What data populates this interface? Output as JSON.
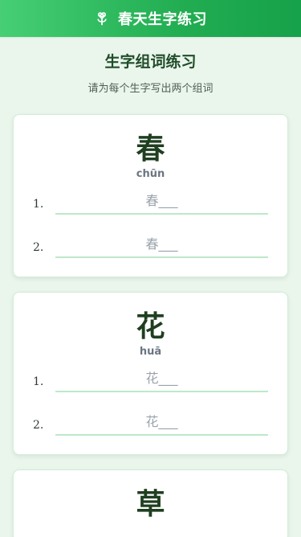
{
  "header": {
    "title": "春天生字练习",
    "icon": "flower-icon",
    "accent": "#22ad52"
  },
  "page": {
    "heading": "生字组词练习",
    "subtitle": "请为每个生字写出两个组词"
  },
  "cards": [
    {
      "char": "春",
      "pinyin": "chūn",
      "rows": [
        {
          "num": "1.",
          "placeholder": "春___"
        },
        {
          "num": "2.",
          "placeholder": "春___"
        }
      ]
    },
    {
      "char": "花",
      "pinyin": "huā",
      "rows": [
        {
          "num": "1.",
          "placeholder": "花___"
        },
        {
          "num": "2.",
          "placeholder": "花___"
        }
      ]
    },
    {
      "char": "草",
      "pinyin": "",
      "rows": []
    }
  ]
}
